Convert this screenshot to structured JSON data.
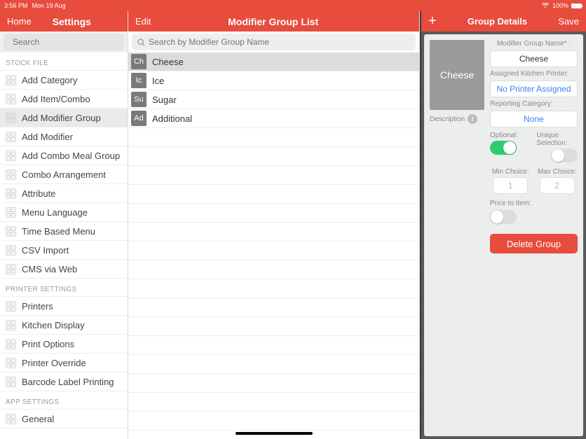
{
  "status": {
    "time": "3:56 PM",
    "date": "Mon 19 Aug",
    "battery": "100%"
  },
  "sidebar": {
    "home": "Home",
    "title": "Settings",
    "searchPlaceholder": "Search",
    "sections": {
      "stock": {
        "header": "STOCK FILE",
        "items": [
          {
            "label": "Add Category",
            "name": "nav-add-category",
            "icon": "grid"
          },
          {
            "label": "Add Item/Combo",
            "name": "nav-add-item",
            "icon": "plus"
          },
          {
            "label": "Add Modifier Group",
            "name": "nav-add-modifier-group",
            "icon": "grid",
            "selected": true
          },
          {
            "label": "Add Modifier",
            "name": "nav-add-modifier",
            "icon": "plus"
          },
          {
            "label": "Add Combo Meal Group",
            "name": "nav-add-combo-meal",
            "icon": "grid"
          },
          {
            "label": "Combo Arrangement",
            "name": "nav-combo-arrangement",
            "icon": "grid"
          },
          {
            "label": "Attribute",
            "name": "nav-attribute",
            "icon": "tag"
          },
          {
            "label": "Menu Language",
            "name": "nav-menu-language",
            "icon": "lang"
          },
          {
            "label": "Time Based Menu",
            "name": "nav-time-based",
            "icon": "clock"
          },
          {
            "label": "CSV Import",
            "name": "nav-csv-import",
            "icon": "doc"
          },
          {
            "label": "CMS via Web",
            "name": "nav-cms",
            "icon": "web"
          }
        ]
      },
      "printer": {
        "header": "PRINTER SETTINGS",
        "items": [
          {
            "label": "Printers",
            "name": "nav-printers",
            "icon": "printer"
          },
          {
            "label": "Kitchen Display",
            "name": "nav-kds",
            "icon": "screen"
          },
          {
            "label": "Print Options",
            "name": "nav-print-options",
            "icon": "sliders"
          },
          {
            "label": "Printer Override",
            "name": "nav-printer-override",
            "icon": "printer"
          },
          {
            "label": "Barcode Label Printing",
            "name": "nav-barcode",
            "icon": "barcode"
          }
        ]
      },
      "app": {
        "header": "APP SETTINGS",
        "items": [
          {
            "label": "General",
            "name": "nav-general",
            "icon": "gear"
          }
        ]
      }
    }
  },
  "middle": {
    "edit": "Edit",
    "title": "Modifier Group List",
    "searchPlaceholder": "Search by Modifier Group Name",
    "items": [
      {
        "abbr": "Ch",
        "label": "Cheese",
        "selected": true
      },
      {
        "abbr": "Ic",
        "label": "Ice"
      },
      {
        "abbr": "Su",
        "label": "Sugar"
      },
      {
        "abbr": "Ad",
        "label": "Additional"
      }
    ]
  },
  "detail": {
    "title": "Group Details",
    "save": "Save",
    "plus": "+",
    "thumbLabel": "Cheese",
    "description": "Description",
    "nameLabel": "Modifier Group Name* :",
    "nameValue": "Cheese",
    "printerLabel": "Assigned Kitchen Printer:",
    "printerValue": "No Printer Assigned",
    "categoryLabel": "Reporting Category:",
    "categoryValue": "None",
    "optionalLabel": "Optional:",
    "optionalValue": true,
    "uniqueLabel": "Unique Selection:",
    "uniqueValue": false,
    "minLabel": "Min Choice:",
    "minValue": "1",
    "maxLabel": "Max Choice:",
    "maxValue": "2",
    "priceLabel": "Price to Item:",
    "priceValue": false,
    "deleteLabel": "Delete Group"
  }
}
